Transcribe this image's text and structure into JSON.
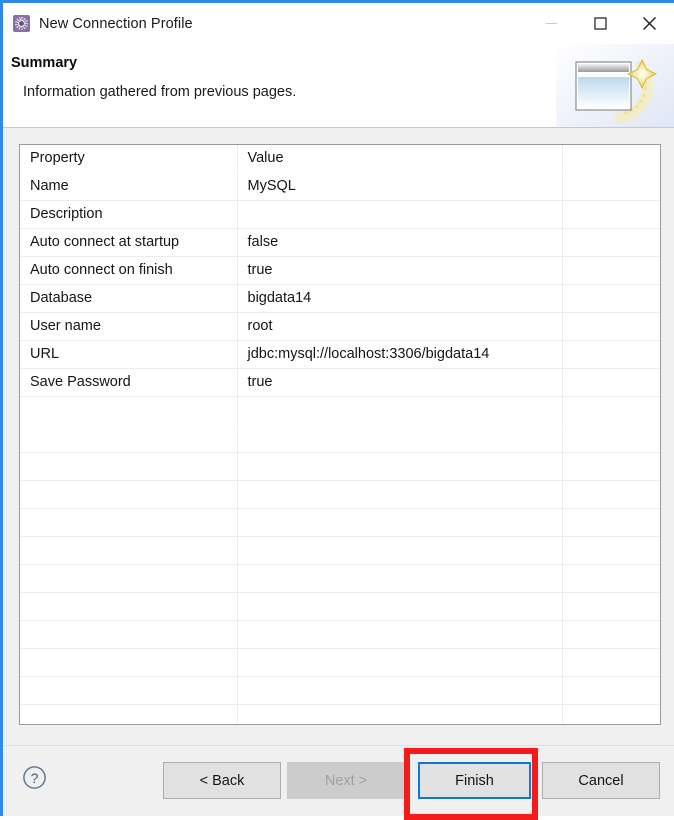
{
  "window": {
    "title": "New Connection Profile",
    "icon": "connection-profile-icon",
    "controls": {
      "minimize": "—",
      "maximize": "□",
      "close": "✕"
    }
  },
  "header": {
    "title": "Summary",
    "subtitle": "Information gathered from previous pages.",
    "art": "wizard-banner-image"
  },
  "table": {
    "columns": [
      "Property",
      "Value",
      ""
    ],
    "rows": [
      {
        "property": "Name",
        "value": "MySQL"
      },
      {
        "property": "Description",
        "value": ""
      },
      {
        "property": "Auto connect at startup",
        "value": "false"
      },
      {
        "property": "Auto connect on finish",
        "value": "true"
      },
      {
        "property": "Database",
        "value": "bigdata14"
      },
      {
        "property": "User name",
        "value": "root"
      },
      {
        "property": "URL",
        "value": "jdbc:mysql://localhost:3306/bigdata14"
      },
      {
        "property": "Save Password",
        "value": "true"
      }
    ],
    "empty_row_count": 12
  },
  "footer": {
    "help_label": "?",
    "buttons": {
      "back": "< Back",
      "next": "Next >",
      "finish": "Finish",
      "cancel": "Cancel"
    }
  },
  "annotation": {
    "highlight_color": "#f51b1b",
    "focus_color": "#0a7ad4",
    "target": "Finish"
  }
}
